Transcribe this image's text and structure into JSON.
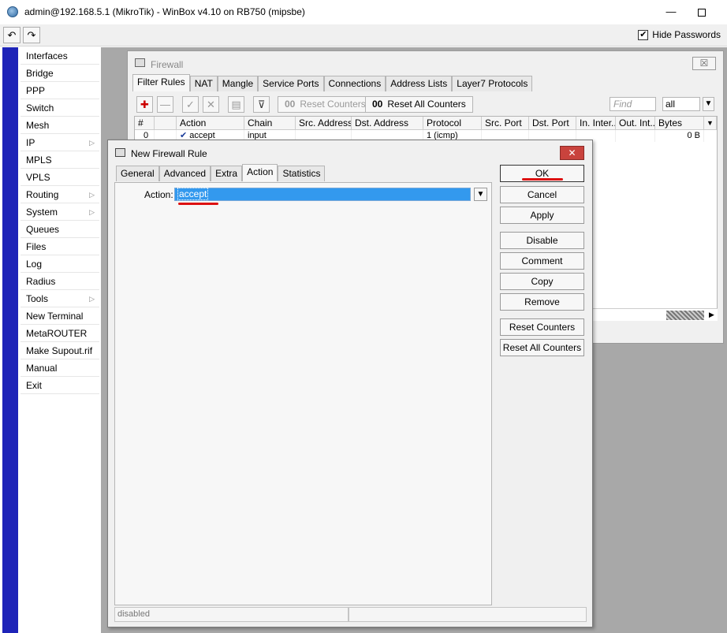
{
  "window": {
    "title": "admin@192.168.5.1 (MikroTik) - WinBox v4.10 on RB750 (mipsbe)",
    "minimize_glyph": "—",
    "close_glyph": "□"
  },
  "toolbar": {
    "undo_glyph": "↶",
    "redo_glyph": "↷",
    "hide_passwords_label": "Hide Passwords",
    "hide_passwords_checked": true,
    "check_glyph": "✔"
  },
  "sidebar": {
    "items": [
      {
        "label": "Interfaces",
        "submenu": false
      },
      {
        "label": "Bridge",
        "submenu": false
      },
      {
        "label": "PPP",
        "submenu": false
      },
      {
        "label": "Switch",
        "submenu": false
      },
      {
        "label": "Mesh",
        "submenu": false
      },
      {
        "label": "IP",
        "submenu": true
      },
      {
        "label": "MPLS",
        "submenu": false
      },
      {
        "label": "VPLS",
        "submenu": false
      },
      {
        "label": "Routing",
        "submenu": true
      },
      {
        "label": "System",
        "submenu": true
      },
      {
        "label": "Queues",
        "submenu": false
      },
      {
        "label": "Files",
        "submenu": false
      },
      {
        "label": "Log",
        "submenu": false
      },
      {
        "label": "Radius",
        "submenu": false
      },
      {
        "label": "Tools",
        "submenu": true
      },
      {
        "label": "New Terminal",
        "submenu": false
      },
      {
        "label": "MetaROUTER",
        "submenu": false
      },
      {
        "label": "Make Supout.rif",
        "submenu": false
      },
      {
        "label": "Manual",
        "submenu": false
      },
      {
        "label": "Exit",
        "submenu": false
      }
    ],
    "submenu_glyph": "▷"
  },
  "firewall": {
    "title": "Firewall",
    "close_glyph": "☒",
    "tabs": [
      "Filter Rules",
      "NAT",
      "Mangle",
      "Service Ports",
      "Connections",
      "Address Lists",
      "Layer7 Protocols"
    ],
    "active_tab": "Filter Rules",
    "tools": {
      "add_glyph": "✚",
      "remove_glyph": "—",
      "enable_glyph": "✓",
      "disable_glyph": "✕",
      "comment_glyph": "▤",
      "filter_glyph": "⊽",
      "reset_counters_label": "Reset Counters",
      "reset_counters_prefix": "00",
      "reset_all_counters_label": "Reset All Counters",
      "reset_all_counters_prefix": "00",
      "find_placeholder": "Find",
      "filter_value": "all",
      "dropdown_glyph": "▼"
    },
    "columns": [
      "#",
      "",
      "Action",
      "Chain",
      "Src. Address",
      "Dst. Address",
      "Protocol",
      "Src. Port",
      "Dst. Port",
      "In. Inter...",
      "Out. Int...",
      "Bytes"
    ],
    "rows": [
      {
        "num": "0",
        "action": "accept",
        "action_glyph": "✔",
        "chain": "input",
        "protocol": "1 (icmp)",
        "bytes": "0 B"
      }
    ],
    "scroll_glyph": "▶"
  },
  "dialog": {
    "title": "New Firewall Rule",
    "close_glyph": "✕",
    "tabs": [
      "General",
      "Advanced",
      "Extra",
      "Action",
      "Statistics"
    ],
    "active_tab": "Action",
    "action_label": "Action:",
    "action_value": "accept",
    "dropdown_glyph": "▼",
    "buttons": [
      "OK",
      "Cancel",
      "Apply",
      "Disable",
      "Comment",
      "Copy",
      "Remove",
      "Reset Counters",
      "Reset All Counters"
    ],
    "status": "disabled",
    "annotation_color": "#dd1111"
  }
}
